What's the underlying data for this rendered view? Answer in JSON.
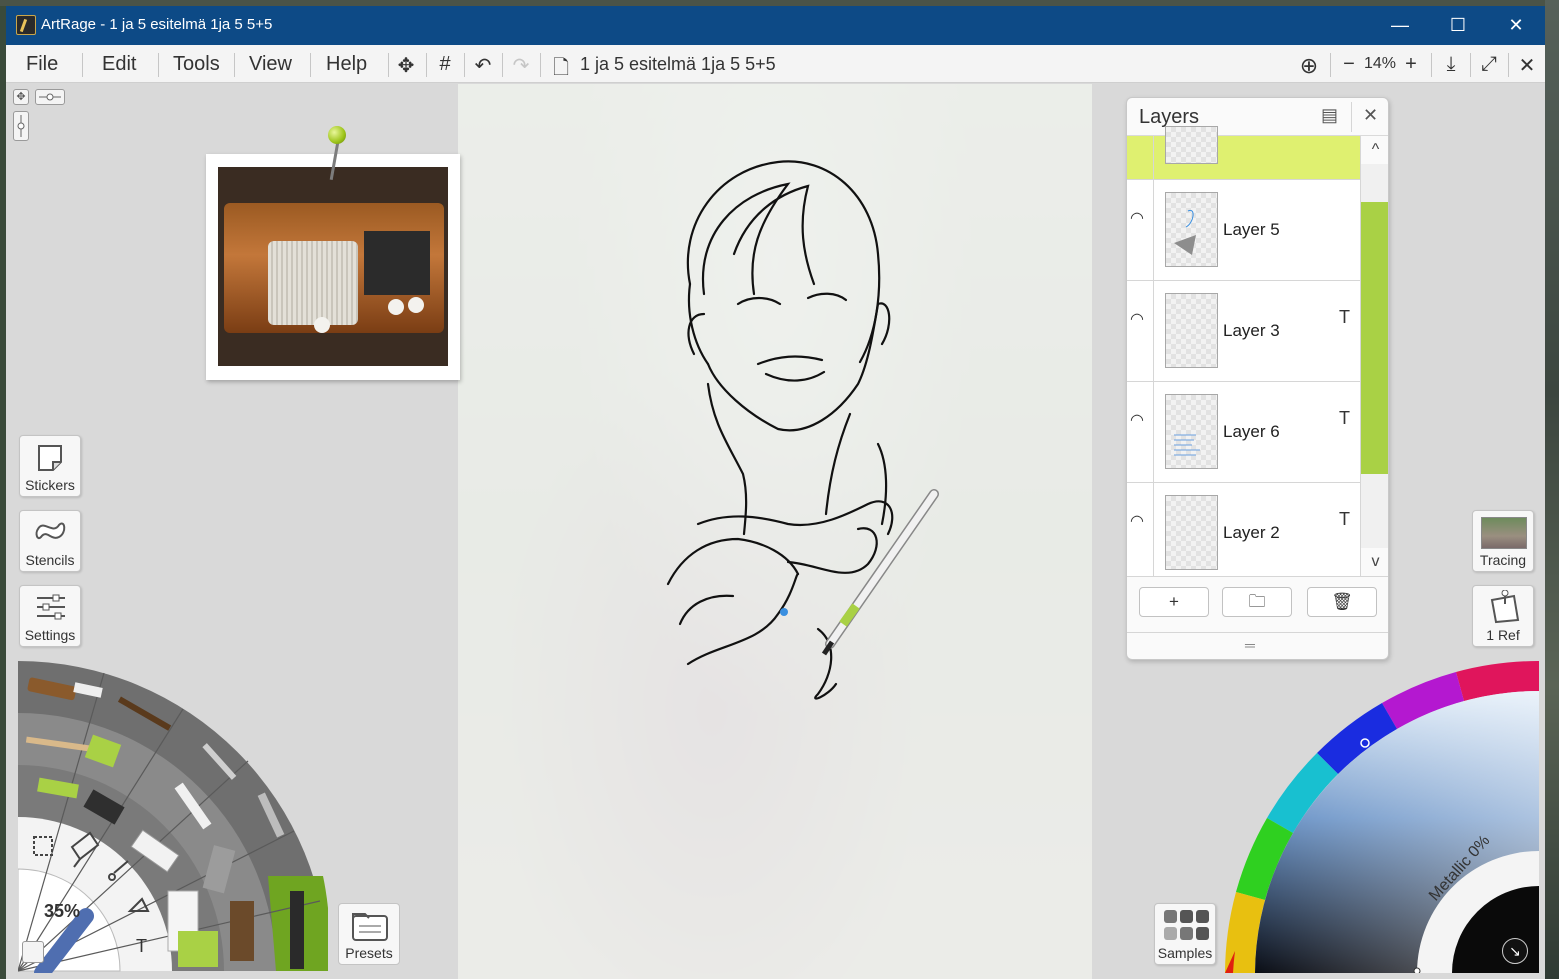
{
  "window": {
    "title": "ArtRage - 1 ja 5 esitelmä 1ja 5  5+5",
    "minimize": "—",
    "maximize": "☐",
    "close": "✕"
  },
  "menu": {
    "items": [
      "File",
      "Edit",
      "Tools",
      "View",
      "Help"
    ],
    "move_icon": "✥",
    "grid_icon": "#",
    "undo_icon": "↶",
    "redo_icon": "↷",
    "doc_icon": "🗋",
    "document_name": "1 ja 5 esitelmä 1ja 5  5+5",
    "zoom_minus": "−",
    "zoom": "14%",
    "zoom_plus": "+",
    "add_ref_icon": "⊕",
    "download_icon": "⤓",
    "expand_icon": "⤢",
    "close_icon": "✕"
  },
  "left_tools": {
    "stickers": "Stickers",
    "stencils": "Stencils",
    "settings": "Settings",
    "brush_size": "35%",
    "presets": "Presets",
    "text_tool": "T"
  },
  "layers": {
    "title": "Layers",
    "menu_icon": "▤",
    "close_icon": "✕",
    "rows": [
      {
        "name": "Layer 5",
        "text_flag": ""
      },
      {
        "name": "Layer 3",
        "text_flag": "T"
      },
      {
        "name": "Layer 6",
        "text_flag": "T"
      },
      {
        "name": "Layer 2",
        "text_flag": "T"
      }
    ],
    "scroll_up": "^",
    "scroll_down": "v",
    "add": "+",
    "folder": "🗀",
    "delete": "🗑",
    "grip": "═"
  },
  "right_tools": {
    "tracing": "Tracing",
    "refs": "1 Ref",
    "samples": "Samples",
    "metallic": "Metallic 0%"
  },
  "colors": {
    "titlebar": "#0d4a86",
    "accent_green": "#a9d145",
    "selected_layer": "#dff070"
  }
}
